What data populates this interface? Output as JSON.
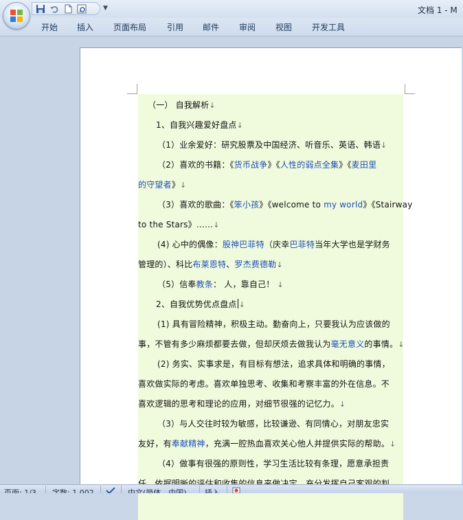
{
  "window": {
    "title": "文档 1 - M",
    "qat_dropdown_icon": "triangle-down"
  },
  "ribbon": {
    "tabs": [
      "开始",
      "插入",
      "页面布局",
      "引用",
      "邮件",
      "审阅",
      "视图",
      "开发工具"
    ]
  },
  "document": {
    "lines": {
      "l1": "（一）  自我解析",
      "l2": "1、自我兴趣爱好盘点",
      "l3": "（1）业余爱好：研究股票及中国经济、听音乐、英语、韩语",
      "l4a": "（2）喜欢的书籍：《",
      "l4b": "货币战争",
      "l4c": "》《",
      "l4d": "人性的弱点全集",
      "l4e": "》《",
      "l4f": "麦田里",
      "l5a": "的守望者",
      "l5b": "》",
      "l6a": "（3）喜欢的歌曲：《",
      "l6b": "笨小孩",
      "l6c": "》《welcome to ",
      "l6d": "my world",
      "l6e": "》《Stairway",
      "l7": "to the Stars》……",
      "l8a": "(4)  心中的偶像：",
      "l8b": "股神巴菲特",
      "l8c": "（庆幸",
      "l8d": "巴菲特",
      "l8e": "当年大学也是学财务",
      "l9a": "管理的）、科比",
      "l9b": "布莱恩特",
      "l9c": "、",
      "l9d": "罗杰费德勒",
      "l10a": "（5）信奉",
      "l10b": "教条",
      "l10c": "：  人，靠自己！",
      "l11": "2、自我优势优点盘点",
      "l12": "(1)  具有冒险精神，积极主动。勤奋向上，只要我认为应该做的",
      "l13a": "事，不管有多少麻烦都要去做，但却厌烦去做我认为",
      "l13b": "毫无意义",
      "l13c": "的事情。",
      "l14": "(2)  务实、实事求是，有目标有想法，追求具体和明确的事情，",
      "l15": "喜欢做实际的考虑。喜欢单独思考、收集和考察丰富的外在信息。不",
      "l16": "喜欢逻辑的思考和理论的应用，对细节很强的记忆力。",
      "l17": "（3）与人交往时较为敏感，比较谦逊、有同情心，对朋友忠实",
      "l18a": "友好，有",
      "l18b": "奉献精神",
      "l18c": "，充满一腔热血喜欢关心他人并提供实际的帮助。",
      "l19": "（4）做事有很强的原则性，学习生活比较有条理，愿意承担责",
      "l20": "任，依据明晰的评估和收集的信息来做决定，充分发挥自己客观的判"
    },
    "paragraph_mark": "↓"
  },
  "statusbar": {
    "page": "页面: 1/3",
    "words": "字数: 1,002",
    "language": "中文(简体，中国)",
    "mode": "插入"
  }
}
